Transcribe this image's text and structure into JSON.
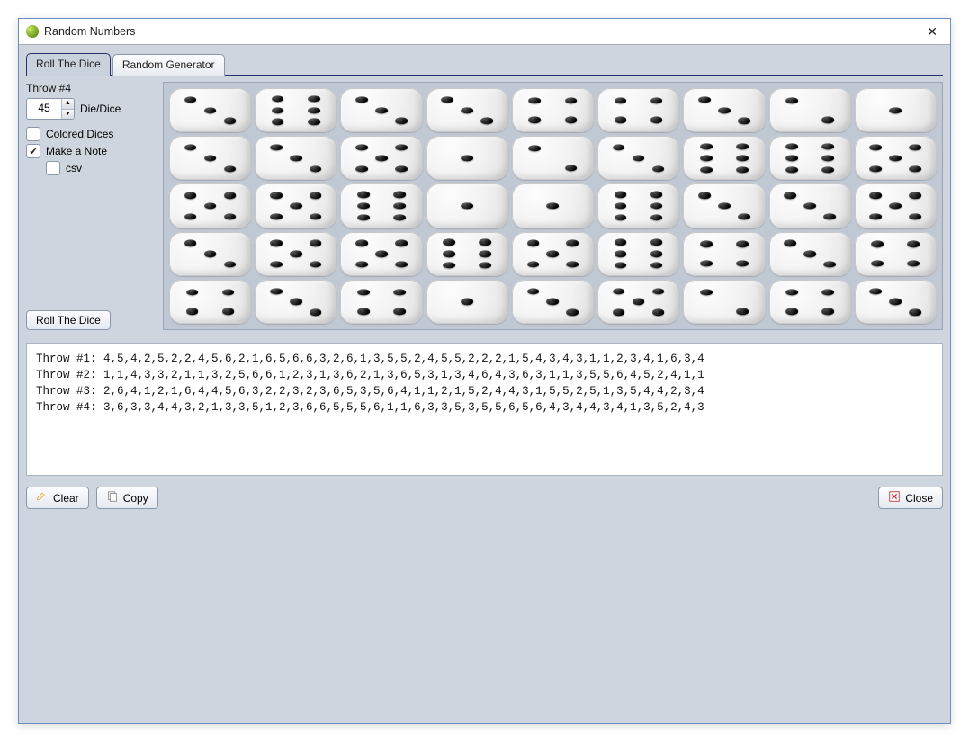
{
  "window": {
    "title": "Random Numbers"
  },
  "tabs": [
    {
      "label": "Roll The Dice",
      "active": true
    },
    {
      "label": "Random Generator",
      "active": false
    }
  ],
  "throw": {
    "label_prefix": "Throw #",
    "number": 4
  },
  "spinner": {
    "value": 45,
    "label": "Die/Dice"
  },
  "options": {
    "colored_dices": {
      "label": "Colored Dices",
      "checked": false
    },
    "make_note": {
      "label": "Make a Note",
      "checked": true
    },
    "csv": {
      "label": "csv",
      "checked": false
    }
  },
  "buttons": {
    "roll": "Roll The Dice",
    "clear": "Clear",
    "copy": "Copy",
    "close": "Close"
  },
  "dice": [
    3,
    6,
    3,
    3,
    4,
    4,
    3,
    2,
    1,
    3,
    3,
    5,
    1,
    2,
    3,
    6,
    6,
    5,
    5,
    5,
    6,
    1,
    1,
    6,
    3,
    3,
    5,
    3,
    5,
    5,
    6,
    5,
    6,
    4,
    3,
    4,
    4,
    3,
    4,
    1,
    3,
    5,
    2,
    4,
    3
  ],
  "log": [
    "Throw #1: 4,5,4,2,5,2,2,4,5,6,2,1,6,5,6,6,3,2,6,1,3,5,5,2,4,5,5,2,2,2,1,5,4,3,4,3,1,1,2,3,4,1,6,3,4",
    "Throw #2: 1,1,4,3,3,2,1,1,3,2,5,6,6,1,2,3,1,3,6,2,1,3,6,5,3,1,3,4,6,4,3,6,3,1,1,3,5,5,6,4,5,2,4,1,1",
    "Throw #3: 2,6,4,1,2,1,6,4,4,5,6,3,2,2,3,2,3,6,5,3,5,6,4,1,1,2,1,5,2,4,4,3,1,5,5,2,5,1,3,5,4,4,2,3,4",
    "Throw #4: 3,6,3,3,4,4,3,2,1,3,3,5,1,2,3,6,6,5,5,5,6,1,1,6,3,3,5,3,5,5,6,5,6,4,3,4,4,3,4,1,3,5,2,4,3"
  ]
}
